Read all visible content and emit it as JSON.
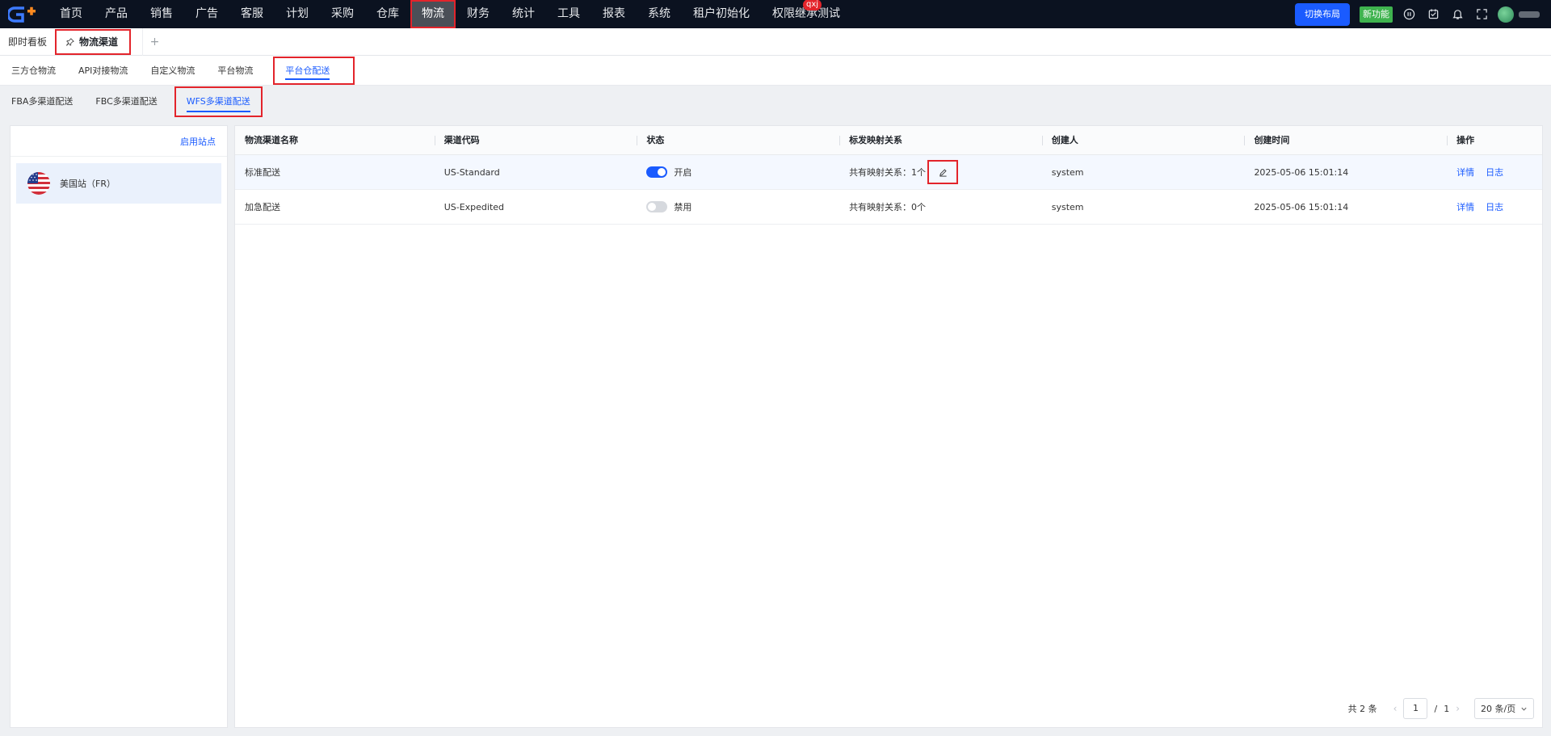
{
  "topnav": {
    "items": [
      "首页",
      "产品",
      "销售",
      "广告",
      "客服",
      "计划",
      "采购",
      "仓库",
      "物流",
      "财务",
      "统计",
      "工具",
      "报表",
      "系统",
      "租户初始化",
      "权限继承测试"
    ],
    "active_item": "物流",
    "badge": "qxj",
    "switch_layout": "切换布局",
    "new_feature": "新功能"
  },
  "tabs": {
    "dashboard": "即时看板",
    "current": "物流渠道",
    "add": "+"
  },
  "subnav1": [
    "三方仓物流",
    "API对接物流",
    "自定义物流",
    "平台物流",
    "平台仓配送"
  ],
  "subnav2": [
    "FBA多渠道配送",
    "FBC多渠道配送",
    "WFS多渠道配送"
  ],
  "left_panel": {
    "enable_link": "启用站点",
    "site": "美国站（FR）"
  },
  "table": {
    "headers": [
      "物流渠道名称",
      "渠道代码",
      "状态",
      "标发映射关系",
      "创建人",
      "创建时间",
      "操作"
    ],
    "rows": [
      {
        "name": "标准配送",
        "code": "US-Standard",
        "enabled": true,
        "status": "开启",
        "mapping": "共有映射关系：1个",
        "creator": "system",
        "created": "2025-05-06 15:01:14",
        "detail": "详情",
        "log": "日志"
      },
      {
        "name": "加急配送",
        "code": "US-Expedited",
        "enabled": false,
        "status": "禁用",
        "mapping": "共有映射关系：0个",
        "creator": "system",
        "created": "2025-05-06 15:01:14",
        "detail": "详情",
        "log": "日志"
      }
    ]
  },
  "pagination": {
    "total": "共 2 条",
    "current": "1",
    "sep": "/",
    "pages": "1",
    "page_size": "20 条/页"
  },
  "colors": {
    "accent": "#1a5bff",
    "highlight": "#e3242b",
    "nav_bg": "#0b1220",
    "success": "#3fb34f"
  }
}
